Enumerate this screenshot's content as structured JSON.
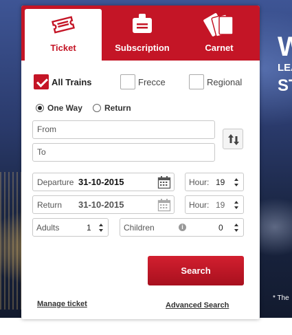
{
  "tabs": [
    {
      "label": "Ticket",
      "icon": "ticket-icon",
      "active": true
    },
    {
      "label": "Subscription",
      "icon": "id-badge-icon",
      "active": false
    },
    {
      "label": "Carnet",
      "icon": "tickets-stack-icon",
      "active": false
    }
  ],
  "train_filters": [
    {
      "label": "All Trains",
      "checked": true
    },
    {
      "label": "Frecce",
      "checked": false
    },
    {
      "label": "Regional",
      "checked": false
    }
  ],
  "trip_type": [
    {
      "label": "One Way",
      "selected": true
    },
    {
      "label": "Return",
      "selected": false
    }
  ],
  "from": {
    "placeholder": "From"
  },
  "to": {
    "placeholder": "To"
  },
  "departure": {
    "label": "Departure",
    "date": "31-10-2015",
    "hour_label": "Hour:",
    "hour": "19"
  },
  "return": {
    "label": "Return",
    "date": "31-10-2015",
    "hour_label": "Hour:",
    "hour": "19"
  },
  "adults": {
    "label": "Adults",
    "value": "1"
  },
  "children": {
    "label": "Children",
    "value": "0",
    "info": "i"
  },
  "search_label": "Search",
  "links": {
    "manage": "Manage ticket",
    "advanced": "Advanced Search"
  },
  "promo": {
    "line1": "W",
    "line2": "LEA",
    "line3": "ST",
    "note": "* The"
  },
  "colors": {
    "brand_red": "#c41526"
  }
}
